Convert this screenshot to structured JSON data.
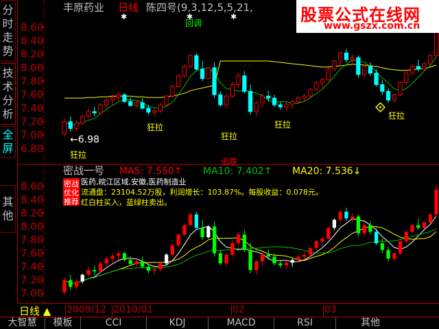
{
  "sidebar": {
    "tabs": [
      {
        "label": "分时走势",
        "chars": [
          "分",
          "时",
          "走",
          "势"
        ]
      },
      {
        "label": "技术分析",
        "chars": [
          "技",
          "术",
          "分",
          "析"
        ]
      },
      {
        "label": "全屏",
        "chars": [
          "全",
          "屏"
        ]
      },
      {
        "label": "其他",
        "chars": [
          "其",
          "他"
        ]
      }
    ]
  },
  "header": {
    "stock": "丰原药业",
    "period": "日线",
    "formula": "陈四号(9,3,12,5,5,21,"
  },
  "watermark": {
    "title": "股票公式在线网",
    "url": "www.gszx.com.cn"
  },
  "top_panel": {
    "y_ticks": [
      "8.60",
      "8.40",
      "8.20",
      "8.00",
      "7.80",
      "7.60",
      "7.40",
      "7.20",
      "7.00",
      "6.80"
    ],
    "annotations": [
      "回调",
      "狂拉",
      "狂拉",
      "狂拉",
      "狂拉",
      "狂拉"
    ],
    "low_label": "←6.98",
    "flag": "追跌"
  },
  "bottom_panel": {
    "title": "密战一号",
    "ma5": "MA5: 7.550↑",
    "ma10": "MA10: 7.402↑",
    "ma20": "MA20: 7.536↓",
    "badge_lines": [
      "密战",
      "优化",
      "推荐"
    ],
    "info_line1": "医药,皖江区域,安徽,医药制造业",
    "info_line2": "流通盘：23104.52万股，利润增长：103.87%。每股收益：0.078元。",
    "info_line3": "红白柱买入，蓝绿柱卖出。",
    "y_ticks": [
      "8.60",
      "8.40",
      "8.20",
      "8.00",
      "7.80",
      "7.60",
      "7.40",
      "7.20",
      "7.00"
    ]
  },
  "date_bar": {
    "period": "日线",
    "labels": [
      "2009/12",
      "2010/01",
      "02",
      "03"
    ]
  },
  "bottom_tabs": [
    "大智慧",
    "模板",
    "CCI",
    "KDJ",
    "MACD",
    "RSI",
    "其他"
  ],
  "colors": {
    "up": "#ff0000",
    "down": "#00ffff",
    "ma_yellow": "#ffff00",
    "ma_green": "#00c000",
    "axis": "#c00000"
  },
  "chart_data": {
    "type": "candlestick",
    "y_range_top": [
      6.85,
      8.7
    ],
    "y_range_bottom": [
      6.9,
      8.7
    ],
    "candles": [
      [
        7.02,
        7.25,
        6.98,
        7.2
      ],
      [
        7.2,
        7.28,
        7.05,
        7.1
      ],
      [
        7.1,
        7.22,
        7.06,
        7.18
      ],
      [
        7.18,
        7.3,
        7.15,
        7.28
      ],
      [
        7.28,
        7.4,
        7.25,
        7.35
      ],
      [
        7.35,
        7.42,
        7.28,
        7.33
      ],
      [
        7.33,
        7.48,
        7.3,
        7.45
      ],
      [
        7.45,
        7.55,
        7.4,
        7.52
      ],
      [
        7.52,
        7.6,
        7.45,
        7.56
      ],
      [
        7.56,
        7.64,
        7.5,
        7.6
      ],
      [
        7.6,
        7.62,
        7.48,
        7.5
      ],
      [
        7.5,
        7.56,
        7.42,
        7.44
      ],
      [
        7.44,
        7.52,
        7.4,
        7.48
      ],
      [
        7.48,
        7.55,
        7.38,
        7.4
      ],
      [
        7.4,
        7.45,
        7.3,
        7.34
      ],
      [
        7.34,
        7.4,
        7.28,
        7.36
      ],
      [
        7.36,
        7.48,
        7.33,
        7.45
      ],
      [
        7.45,
        7.6,
        7.42,
        7.58
      ],
      [
        7.58,
        7.75,
        7.55,
        7.72
      ],
      [
        7.72,
        7.9,
        7.7,
        7.88
      ],
      [
        7.88,
        8.05,
        7.85,
        8.02
      ],
      [
        8.02,
        8.2,
        8.0,
        8.18
      ],
      [
        8.18,
        8.22,
        7.95,
        7.98
      ],
      [
        7.98,
        8.1,
        7.8,
        7.84
      ],
      [
        7.84,
        8.02,
        7.82,
        8.0
      ],
      [
        8.0,
        8.08,
        7.55,
        7.6
      ],
      [
        7.6,
        7.65,
        7.42,
        7.45
      ],
      [
        7.45,
        7.62,
        7.4,
        7.58
      ],
      [
        7.58,
        7.8,
        7.55,
        7.75
      ],
      [
        7.75,
        7.92,
        7.7,
        7.88
      ],
      [
        7.88,
        7.95,
        7.62,
        7.65
      ],
      [
        7.65,
        7.75,
        7.3,
        7.35
      ],
      [
        7.35,
        7.5,
        7.28,
        7.48
      ],
      [
        7.48,
        7.62,
        7.42,
        7.58
      ],
      [
        7.58,
        7.66,
        7.5,
        7.55
      ],
      [
        7.55,
        7.6,
        7.42,
        7.45
      ],
      [
        7.45,
        7.5,
        7.38,
        7.42
      ],
      [
        7.42,
        7.48,
        7.36,
        7.46
      ],
      [
        7.46,
        7.52,
        7.4,
        7.5
      ],
      [
        7.5,
        7.58,
        7.46,
        7.55
      ],
      [
        7.55,
        7.62,
        7.5,
        7.58
      ],
      [
        7.58,
        7.7,
        7.55,
        7.68
      ],
      [
        7.68,
        7.8,
        7.65,
        7.78
      ],
      [
        7.78,
        7.85,
        7.7,
        7.82
      ],
      [
        7.82,
        8.0,
        7.8,
        7.98
      ],
      [
        7.98,
        8.12,
        7.95,
        8.1
      ],
      [
        8.1,
        8.25,
        8.05,
        8.22
      ],
      [
        8.22,
        8.28,
        8.08,
        8.12
      ],
      [
        8.12,
        8.2,
        8.05,
        8.15
      ],
      [
        8.15,
        8.18,
        7.85,
        7.9
      ],
      [
        7.9,
        8.05,
        7.86,
        8.02
      ],
      [
        8.02,
        8.08,
        7.88,
        7.92
      ],
      [
        7.92,
        7.98,
        7.72,
        7.75
      ],
      [
        7.75,
        7.82,
        7.6,
        7.65
      ],
      [
        7.65,
        7.7,
        7.48,
        7.52
      ],
      [
        7.52,
        7.62,
        7.48,
        7.6
      ],
      [
        7.6,
        7.8,
        7.58,
        7.78
      ],
      [
        7.78,
        7.95,
        7.75,
        7.92
      ],
      [
        7.92,
        8.05,
        7.9,
        8.02
      ],
      [
        8.02,
        8.12,
        7.95,
        7.98
      ],
      [
        7.98,
        8.08,
        7.96,
        8.06
      ],
      [
        8.06,
        8.2,
        8.04,
        8.18
      ],
      [
        8.18,
        8.62,
        8.15,
        8.55
      ]
    ],
    "ma_yellow_top": [
      7.55,
      7.55,
      7.55,
      7.55,
      7.56,
      7.56,
      7.57,
      7.57,
      7.58,
      7.58,
      7.58,
      7.58,
      7.57,
      7.57,
      7.56,
      7.56,
      7.56,
      7.57,
      7.58,
      7.6,
      7.62,
      7.66,
      7.68,
      7.7,
      7.72,
      7.74,
      8.1,
      8.1,
      8.1,
      8.1,
      8.1,
      8.1,
      8.1,
      8.1,
      8.1,
      8.09,
      8.08,
      8.07,
      8.06,
      8.05,
      8.04,
      8.03,
      8.02,
      8.01,
      8.01,
      8.02,
      8.03,
      8.04,
      8.05,
      8.05,
      8.04,
      8.03,
      8.02,
      8.0,
      7.98,
      7.97,
      7.96,
      7.96,
      7.97,
      7.98,
      7.99,
      8.01,
      8.04
    ]
  }
}
